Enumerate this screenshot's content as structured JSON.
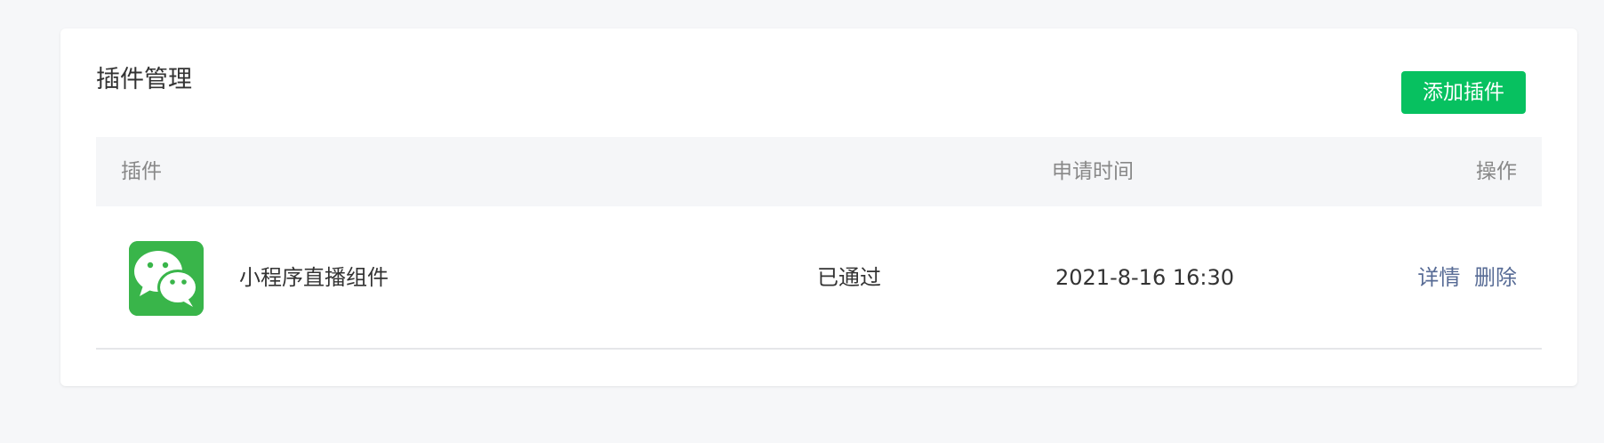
{
  "panel": {
    "title": "插件管理",
    "add_button_label": "添加插件"
  },
  "table": {
    "headers": {
      "plugin": "插件",
      "apply_time": "申请时间",
      "actions": "操作"
    },
    "rows": [
      {
        "icon": "wechat-icon",
        "name": "小程序直播组件",
        "status": "已通过",
        "apply_time": "2021-8-16 16:30",
        "actions": {
          "detail": "详情",
          "delete": "删除"
        }
      }
    ]
  },
  "colors": {
    "primary_green": "#07c160",
    "icon_green": "#39b54a",
    "link_blue": "#576b95",
    "page_bg": "#f6f7f9",
    "header_bg": "#f5f6f8"
  }
}
